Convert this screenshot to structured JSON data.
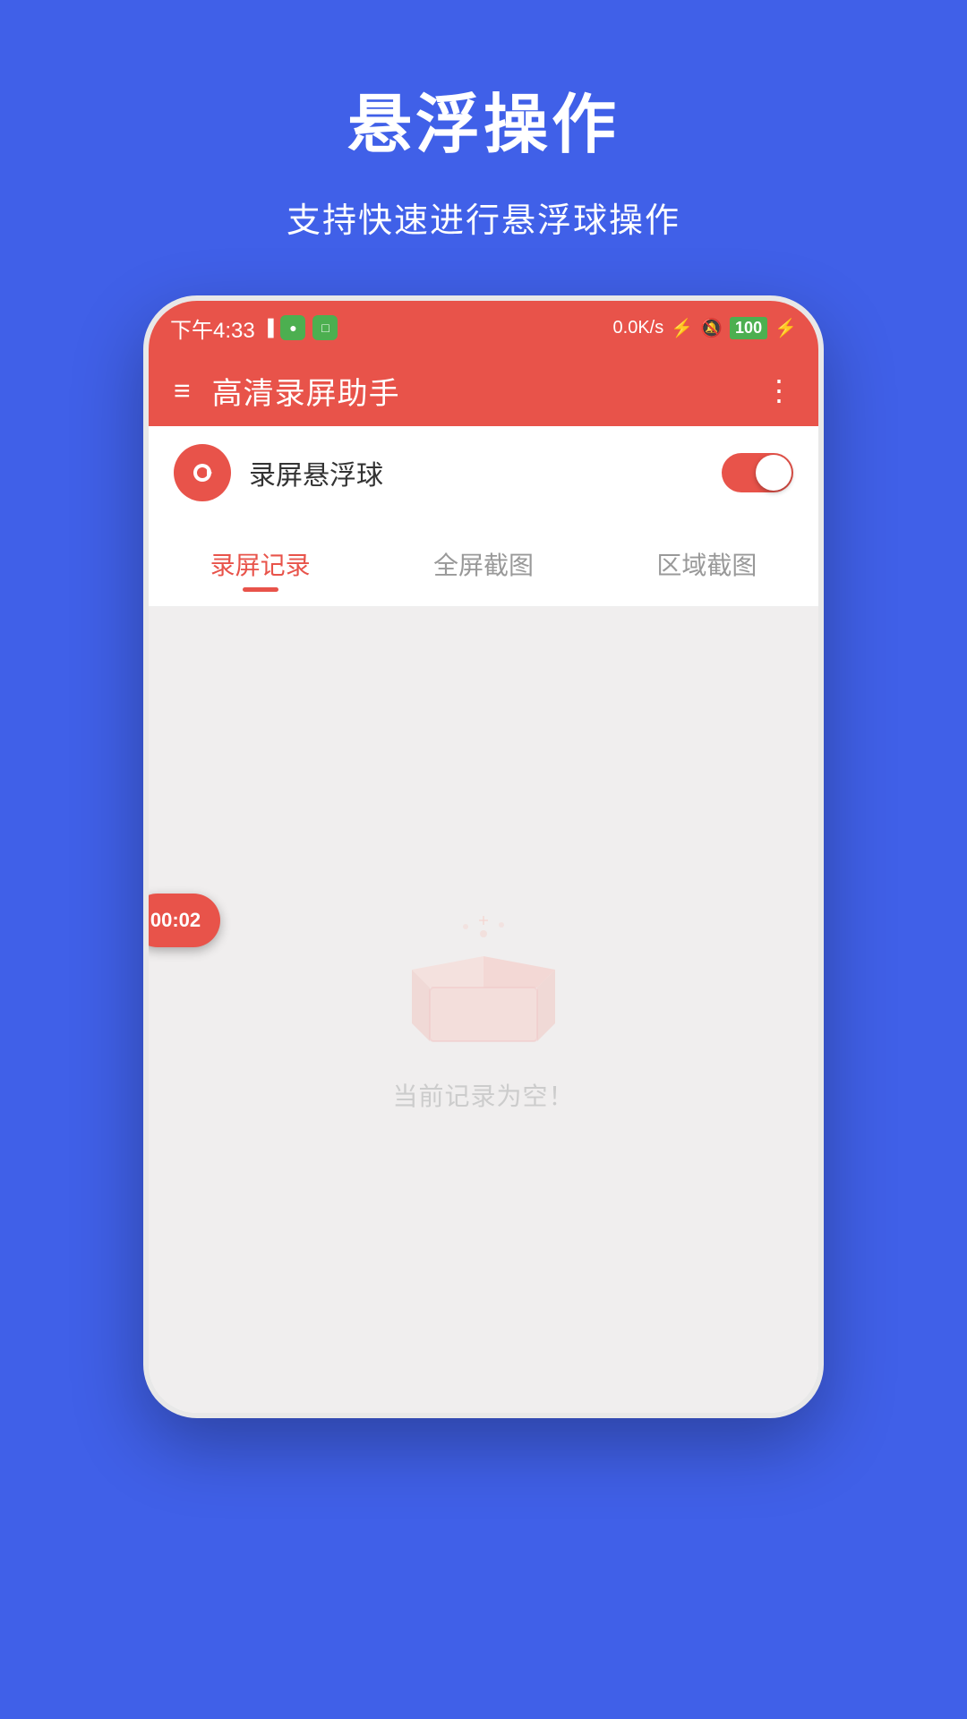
{
  "page": {
    "title": "悬浮操作",
    "subtitle": "支持快速进行悬浮球操作"
  },
  "status_bar": {
    "time": "下午4:33",
    "speed": "0.0K/s",
    "battery": "100"
  },
  "toolbar": {
    "title": "高清录屏助手",
    "menu_icon": "≡",
    "more_icon": "⋮"
  },
  "toggle_section": {
    "label": "录屏悬浮球",
    "enabled": true
  },
  "tabs": [
    {
      "label": "录屏记录",
      "active": true
    },
    {
      "label": "全屏截图",
      "active": false
    },
    {
      "label": "区域截图",
      "active": false
    }
  ],
  "content": {
    "empty_text": "当前记录为空！"
  },
  "floating_ball": {
    "timer": "00:02"
  }
}
